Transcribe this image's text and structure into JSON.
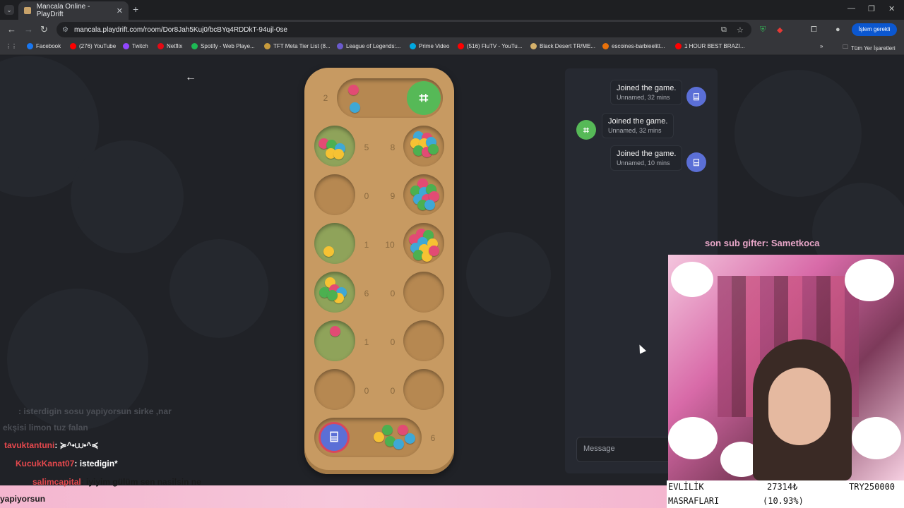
{
  "browser": {
    "tab_title": "Mancala Online - PlayDrift",
    "url": "mancala.playdrift.com/room/Dor8Jah5Kuj0/bcBYq4RDDkT-94ujl-0se",
    "update_label": "İşlem gerekli",
    "bookmarks": [
      {
        "label": "Facebook",
        "color": "#1877f2"
      },
      {
        "label": "(276) YouTube",
        "color": "#ff0000"
      },
      {
        "label": "Twitch",
        "color": "#9146ff"
      },
      {
        "label": "Netflix",
        "color": "#e50914"
      },
      {
        "label": "Spotify - Web Playe...",
        "color": "#1db954"
      },
      {
        "label": "TFT Meta Tier List (8...",
        "color": "#c89b3c"
      },
      {
        "label": "League of Legends:...",
        "color": "#6a5acd"
      },
      {
        "label": "Prime Video",
        "color": "#00a8e1"
      },
      {
        "label": "(516) FluTV - YouTu...",
        "color": "#ff0000"
      },
      {
        "label": "Black Desert TR/ME...",
        "color": "#d4b06a"
      },
      {
        "label": "escoines-barbieelitt...",
        "color": "#e8710a"
      },
      {
        "label": "1 HOUR BEST BRAZI...",
        "color": "#ff0000"
      }
    ],
    "all_bookmarks_label": "Tüm Yer İşaretleri"
  },
  "game": {
    "top_store_count": "2",
    "bottom_store_count": "6",
    "left_counts": [
      "5",
      "0",
      "1",
      "6",
      "1",
      "0"
    ],
    "right_counts": [
      "8",
      "9",
      "10",
      "0",
      "0",
      "0"
    ],
    "top_player_icon": "⌗",
    "bottom_player_icon": "⌸"
  },
  "chat": {
    "messages": [
      {
        "text": "Joined the game.",
        "sub": "Unnamed, 32 mins",
        "side": "right",
        "avatar_color": "#5b6fd6"
      },
      {
        "text": "Joined the game.",
        "sub": "Unnamed, 32 mins",
        "side": "left",
        "avatar_color": "#56b957"
      },
      {
        "text": "Joined the game.",
        "sub": "Unnamed, 10 mins",
        "side": "right",
        "avatar_color": "#5b6fd6"
      }
    ],
    "input_placeholder": "Message"
  },
  "stream": {
    "gifter": "son sub gifter: Sametkoca",
    "counter_label_1": "EVLİLİK",
    "counter_label_2": "MASRAFLARI",
    "counter_value": "27314₺",
    "counter_percent": "(10.93%)",
    "counter_target": "TRY250000",
    "chat": [
      {
        "user": "",
        "text": ": isterdigin sosu yapiyorsun sirke ,nar",
        "user_color": "#555"
      },
      {
        "user": "",
        "text": "ekşisi limon tuz falan",
        "user_color": "#555"
      },
      {
        "user": "tavuktantuni",
        "text": ": ≽^•⩊•^≼",
        "user_color": "#e5484d"
      },
      {
        "user": "KucukKanat07",
        "text": ": istedigin*",
        "user_color": "#e5484d"
      },
      {
        "user": "salimcapital",
        "text": ": iyiyim gülüm sen nasilsin ne",
        "user_color": "#e5484d"
      },
      {
        "user": "",
        "text": "yapiyorsun",
        "user_color": "#fff"
      }
    ]
  }
}
